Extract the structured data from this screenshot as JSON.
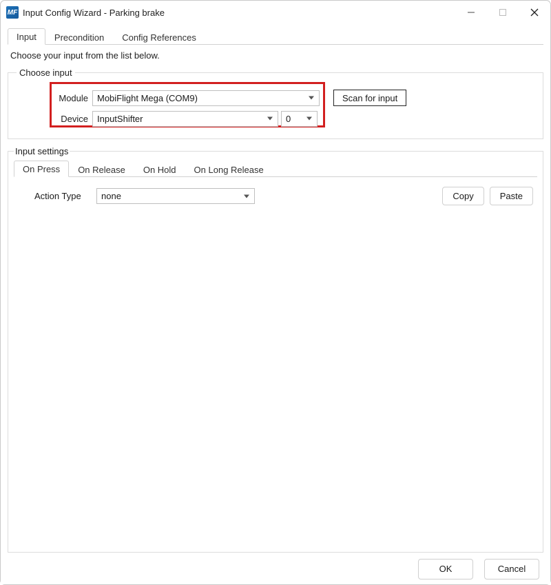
{
  "titlebar": {
    "app_icon_text": "MF",
    "title": "Input Config Wizard - Parking brake"
  },
  "top_tabs": {
    "items": [
      "Input",
      "Precondition",
      "Config References"
    ],
    "active_index": 0
  },
  "instruction": "Choose your input from the list below.",
  "choose_input": {
    "legend": "Choose input",
    "module_label": "Module",
    "module_value": "MobiFlight Mega (COM9)",
    "device_label": "Device",
    "device_value": "InputShifter",
    "device_index_value": "0",
    "scan_button": "Scan for input"
  },
  "input_settings": {
    "legend": "Input settings",
    "sub_tabs": {
      "items": [
        "On Press",
        "On Release",
        "On Hold",
        "On Long Release"
      ],
      "active_index": 0
    },
    "action_type_label": "Action Type",
    "action_type_value": "none",
    "copy_button": "Copy",
    "paste_button": "Paste"
  },
  "footer": {
    "ok": "OK",
    "cancel": "Cancel"
  },
  "highlight": {
    "color": "#d21f1f",
    "target": "module-device-selectors"
  }
}
